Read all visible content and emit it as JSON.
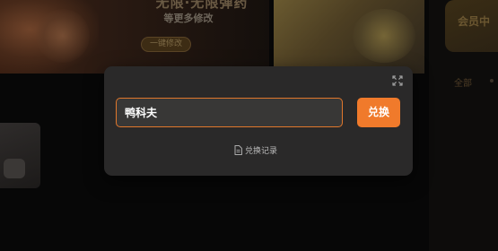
{
  "background": {
    "banner": {
      "headline": "无限·无限弹药",
      "subtitle": "等更多修改",
      "cta_label": "一键修改"
    },
    "vip_card": {
      "title": "会员中"
    },
    "filter": {
      "tab_label": "全部"
    }
  },
  "redeem_modal": {
    "code_input_value": "鸭科夫",
    "redeem_button_label": "兑换",
    "history_link_label": "兑换记录",
    "close_icon": "close-icon",
    "history_icon": "document-icon",
    "accent_color": "#f07a2b"
  }
}
